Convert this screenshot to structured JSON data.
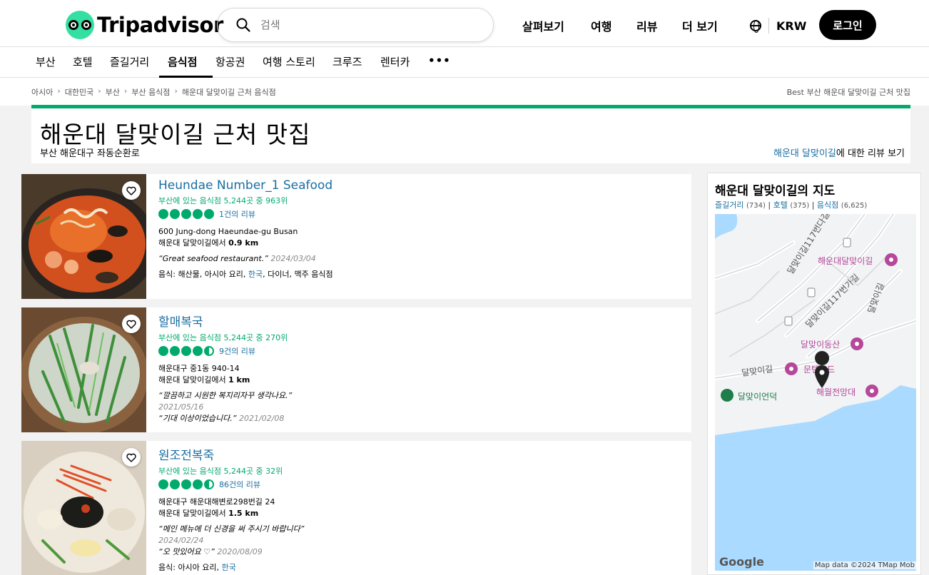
{
  "header": {
    "logo_text": "Tripadvisor",
    "search_placeholder": "검색",
    "nav": [
      "살펴보기",
      "여행",
      "리뷰",
      "더 보기"
    ],
    "currency": "KRW",
    "login_label": "로그인"
  },
  "subnav": {
    "items": [
      "부산",
      "호텔",
      "즐길거리",
      "음식점",
      "항공권",
      "여행 스토리",
      "크루즈",
      "렌터카"
    ],
    "more": "•••",
    "active": "음식점"
  },
  "breadcrumb": {
    "items": [
      "아시아",
      "대한민국",
      "부산",
      "부산 음식점",
      "해운대 달맞이길 근처 음식점"
    ],
    "right_text": "Best 부산 해운대 달맞이길 근처 맛집"
  },
  "title": {
    "heading": "해운대 달맞이길 근처 맛집",
    "address": "부산 해운대구 좌동순환로",
    "reviews_link": "해운대 달맞이길",
    "reviews_suffix": "에 대한 리뷰 보기"
  },
  "restaurants": [
    {
      "name": "Heundae Number_1 Seafood",
      "rank": "부산에 있는 음식점 5,244곳 중 963위",
      "rating": 5.0,
      "review_count": "1건의 리뷰",
      "address": "600 Jung-dong Haeundae-gu Busan",
      "distance_prefix": "해운대 달맞이길에서 ",
      "distance": "0.9 km",
      "quotes": [
        {
          "text": "“Great seafood restaurant.”",
          "date": "2024/03/04"
        }
      ],
      "cuisine_prefix": "음식: 해산물, 아시아 요리, ",
      "cuisine_link": "한국",
      "cuisine_suffix": ", 다이너, 맥주 음식점"
    },
    {
      "name": "할매복국",
      "rank": "부산에 있는 음식점 5,244곳 중 270위",
      "rating": 4.5,
      "review_count": "9건의 리뷰",
      "address": "해운대구 중1동 940-14",
      "distance_prefix": "해운대 달맞이길에서 ",
      "distance": "1 km",
      "quotes": [
        {
          "text": "“깔끔하고 시원한 복지리자꾸 생각나요.”",
          "date": "2021/05/16"
        },
        {
          "text": "“기대 이상이었습니다.”",
          "date": "2021/02/08"
        }
      ],
      "cuisine_prefix": "",
      "cuisine_link": "",
      "cuisine_suffix": ""
    },
    {
      "name": "원조전복죽",
      "rank": "부산에 있는 음식점 5,244곳 중 32위",
      "rating": 4.5,
      "review_count": "86건의 리뷰",
      "address": "해운대구 해운대해변로298번길 24",
      "distance_prefix": "해운대 달맞이길에서 ",
      "distance": "1.5 km",
      "quotes": [
        {
          "text": "“메인 메뉴에 더 신경을 써 주시기 바랍니다”",
          "date": "2024/02/24"
        },
        {
          "text": "“오 맛있어요 ♡”",
          "date": "2020/08/09"
        }
      ],
      "cuisine_prefix": "음식: 아시아 요리, ",
      "cuisine_link": "한국",
      "cuisine_suffix": ""
    }
  ],
  "map": {
    "title": "해운대 달맞이길의 지도",
    "cat1": "즐길거리",
    "cat1_count": "(734)",
    "cat2": "호텔",
    "cat2_count": "(375)",
    "cat3": "음식점",
    "cat3_count": "(6,625)",
    "labels": {
      "road1": "달맞이길117번다길",
      "road2": "달맞이길117번가길",
      "road3": "달맞이길",
      "road4": "달맞이길",
      "poi1": "해운대달맞이길",
      "poi2": "달맞이동산",
      "poi3": "문텐로드",
      "poi4": "해월전망대",
      "poi5": "달맞이언덕"
    },
    "google": "Google",
    "attribution": "Map data ©2024 TMap Mob"
  },
  "colors": {
    "brand_green": "#00aa6c",
    "logo_mint": "#34e0a1",
    "link_blue": "#1a6ea2",
    "water": "#aadaff"
  }
}
